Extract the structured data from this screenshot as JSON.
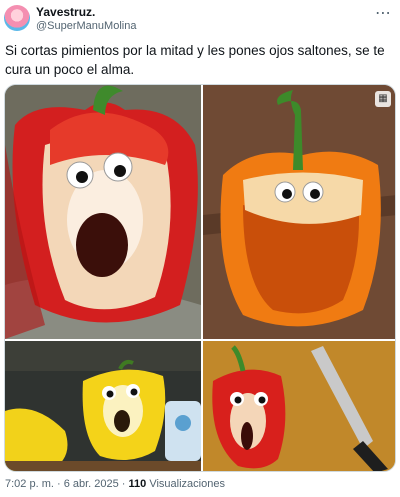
{
  "author": {
    "name": "Yavestruz.",
    "handle": "@SuperManuMolina"
  },
  "tweet": {
    "text": "Si cortas pimientos por la mitad y les pones ojos saltones, se te cura un poco el alma."
  },
  "media": [
    {
      "label": "red-pepper-face"
    },
    {
      "label": "orange-pepper-face"
    },
    {
      "label": "yellow-pepper-face"
    },
    {
      "label": "small-red-pepper-face"
    }
  ],
  "footer": {
    "time": "7:02 p. m. · 6 abr. 2025 · ",
    "views_count": "110",
    "views_label": " Visualizaciones"
  },
  "icons": {
    "more": "more-icon"
  }
}
